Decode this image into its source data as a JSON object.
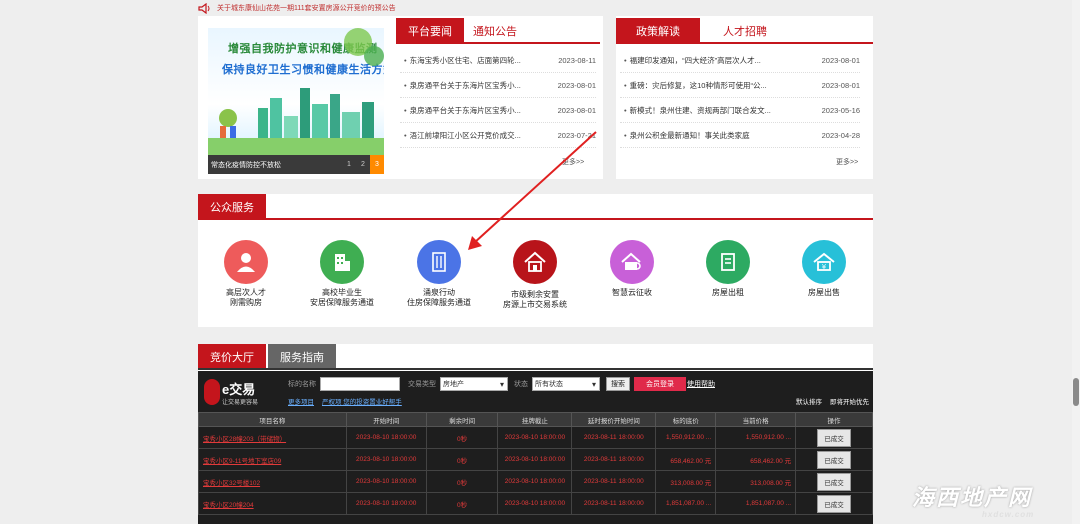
{
  "ticker": {
    "text": "关于城东康仙山花苑一期111套安置房源公开竞价的预公告"
  },
  "news": {
    "slide": {
      "line1": "增强自我防护意识和健康监测",
      "line2": "保持良好卫生习惯和健康生活方式",
      "caption": "常态化疫情防控不放松",
      "pages": [
        "1",
        "2",
        "3"
      ]
    },
    "tabs": [
      "平台要闻",
      "通知公告"
    ],
    "items": [
      {
        "title": "东海宝秀小区住宅、店面第四轮...",
        "date": "2023-08-11"
      },
      {
        "title": "泉房通平台关于东海片区宝秀小...",
        "date": "2023-08-01"
      },
      {
        "title": "泉房通平台关于东海片区宝秀小...",
        "date": "2023-08-01"
      },
      {
        "title": "浯江前埭阳江小区公开竞价成交...",
        "date": "2023-07-21"
      }
    ],
    "more": "更多>>"
  },
  "policy": {
    "tabs": [
      "政策解读",
      "人才招聘"
    ],
    "items": [
      {
        "title": "福建印发通知，“四大经济”高层次人才...",
        "date": "2023-08-01"
      },
      {
        "title": "重磅：灾后修复，这10种情形可使用“公...",
        "date": "2023-08-01"
      },
      {
        "title": "新模式！泉州住建、资规两部门联合发文...",
        "date": "2023-05-16"
      },
      {
        "title": "泉州公积金最新通知！事关此类家庭",
        "date": "2023-04-28"
      }
    ],
    "more": "更多>>"
  },
  "service": {
    "title": "公众服务",
    "items": [
      {
        "label1": "高层次人才",
        "label2": "刚需购房",
        "color": "#ee5b5b",
        "icon": "person-icon"
      },
      {
        "label1": "高校毕业生",
        "label2": "安居保障服务通道",
        "color": "#3fae52",
        "icon": "building-icon"
      },
      {
        "label1": "涌泉行动",
        "label2": "住房保障服务通道",
        "color": "#4b74e6",
        "icon": "apartment-icon"
      },
      {
        "label1": "市级剩余安置",
        "label2": "房源上市交易系统",
        "color": "#b8141a",
        "icon": "house-icon"
      },
      {
        "label1": "智慧云征收",
        "label2": "",
        "color": "#c860d8",
        "icon": "house-search-icon"
      },
      {
        "label1": "房屋出租",
        "label2": "",
        "color": "#2daa62",
        "icon": "rent-icon"
      },
      {
        "label1": "房屋出售",
        "label2": "",
        "color": "#27c0d8",
        "icon": "sale-icon"
      }
    ]
  },
  "bid": {
    "tabs": [
      "竞价大厅",
      "服务指南"
    ],
    "brand": "e交易",
    "slogan": "让交易更容易",
    "filters": {
      "name_label": "标的名称",
      "type_label": "交易类型",
      "type_value": "房地产",
      "status_label": "状态",
      "status_value": "所有状态",
      "search": "搜索",
      "login": "会员登录",
      "help": "使用帮助"
    },
    "links": [
      "更多项目",
      "严权项 您的投资置业好帮手"
    ],
    "sorts": [
      "默认排序",
      "即将开始优先"
    ],
    "columns": [
      "项目名称",
      "开始时间",
      "剩余时间",
      "挂牌截止",
      "延时报价开始时间",
      "标的底价",
      "当前价格",
      "操作"
    ],
    "rows": [
      {
        "name": "宝秀小区28幢203（带储物）",
        "start": "2023-08-10 18:00:00",
        "remain": "0秒",
        "end": "2023-08-10 18:00:00",
        "delay": "2023-08-11 18:00:00",
        "base": "1,550,912.00 ...",
        "current": "1,550,912.00 ...",
        "action": "已成交"
      },
      {
        "name": "宝秀小区9-11号地下室店09",
        "start": "2023-08-10 18:00:00",
        "remain": "0秒",
        "end": "2023-08-10 18:00:00",
        "delay": "2023-08-11 18:00:00",
        "base": "658,462.00 元",
        "current": "658,462.00 元",
        "action": "已成交"
      },
      {
        "name": "宝秀小区32号楼102",
        "start": "2023-08-10 18:00:00",
        "remain": "0秒",
        "end": "2023-08-10 18:00:00",
        "delay": "2023-08-11 18:00:00",
        "base": "313,008.00 元",
        "current": "313,008.00 元",
        "action": "已成交"
      },
      {
        "name": "宝秀小区20幢204",
        "start": "2023-08-10 18:00:00",
        "remain": "0秒",
        "end": "2023-08-10 18:00:00",
        "delay": "2023-08-11 18:00:00",
        "base": "1,851,087.00 ...",
        "current": "1,851,087.00 ...",
        "action": "已成交"
      }
    ]
  },
  "watermark": {
    "big": "海西地产网",
    "small": "hxdcw.com"
  },
  "colors": {
    "accent": "#c4151c",
    "dark": "#1e1e1e"
  }
}
